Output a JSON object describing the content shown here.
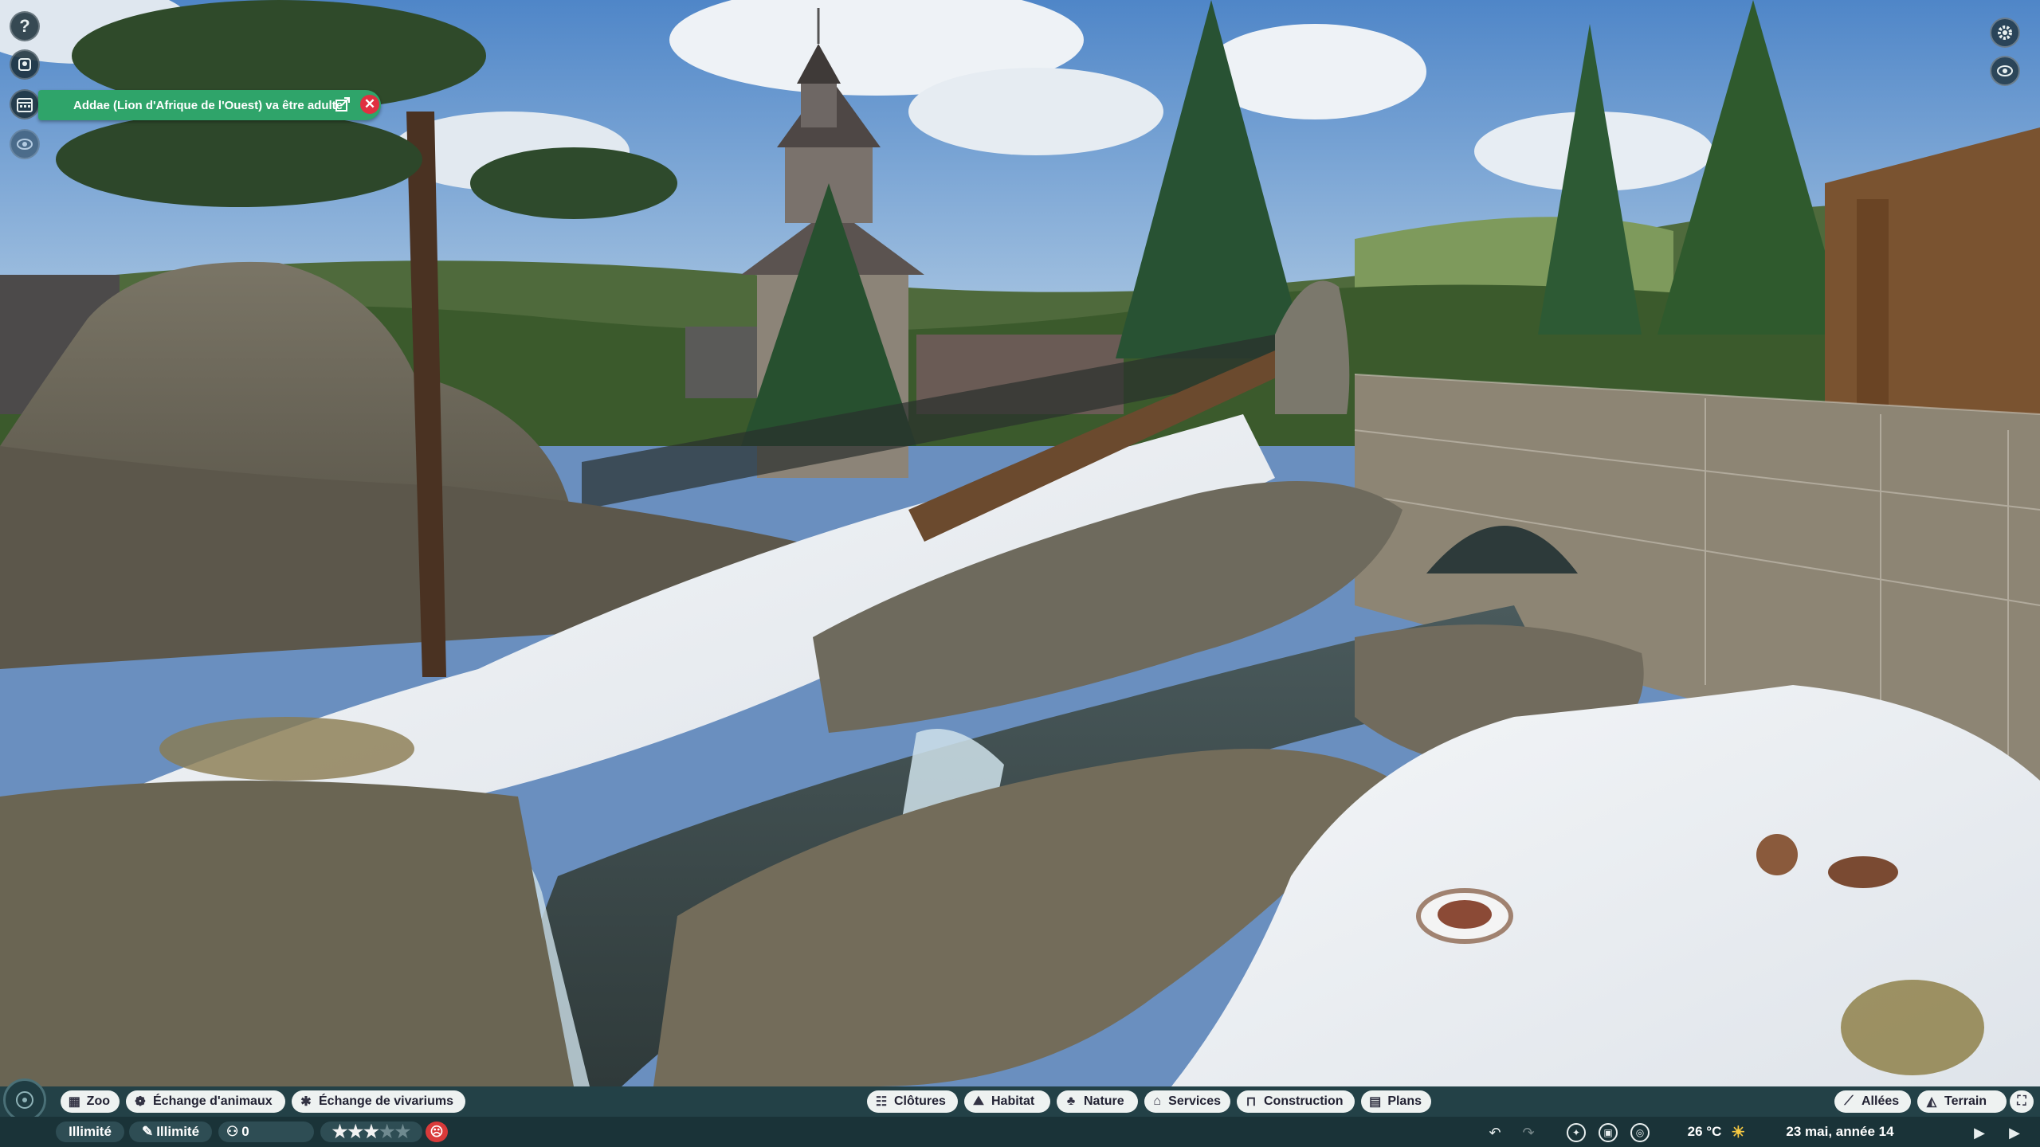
{
  "left_tools": {
    "help_icon": "question-mark-icon",
    "animal_icon": "animal-profile-icon",
    "calendar_icon": "calendar-icon",
    "eye_icon": "eye-icon"
  },
  "notification": {
    "text": "Addae (Lion d'Afrique de l'Ouest) va être adulte",
    "bg_color": "#2fa46a",
    "close_color": "#e03040"
  },
  "top_right": {
    "settings_icon": "gear-icon",
    "view_icon": "eye-toggle-icon"
  },
  "bottom_bar": {
    "left_buttons": [
      {
        "label": "Zoo",
        "icon": "zoo-icon"
      },
      {
        "label": "Échange d'animaux",
        "icon": "paw-icon"
      },
      {
        "label": "Échange de vivariums",
        "icon": "bug-icon"
      }
    ],
    "center_buttons": [
      {
        "label": "Clôtures",
        "icon": "fence-icon"
      },
      {
        "label": "Habitat",
        "icon": "habitat-icon"
      },
      {
        "label": "Nature",
        "icon": "tree-icon"
      },
      {
        "label": "Services",
        "icon": "shop-icon"
      },
      {
        "label": "Construction",
        "icon": "construction-icon"
      },
      {
        "label": "Plans",
        "icon": "blueprint-icon"
      }
    ],
    "right_buttons": [
      {
        "label": "Allées",
        "icon": "path-icon"
      },
      {
        "label": "Terrain",
        "icon": "terrain-icon"
      }
    ],
    "stats": {
      "money": "Illimité",
      "research": "Illimité",
      "guests": "0",
      "rating_stars": 3,
      "rating_max": 5,
      "alert_color": "#d93a3a"
    },
    "status": {
      "temperature": "26 °C",
      "date": "23 mai, année 14",
      "weather_icon": "sun-icon"
    }
  }
}
